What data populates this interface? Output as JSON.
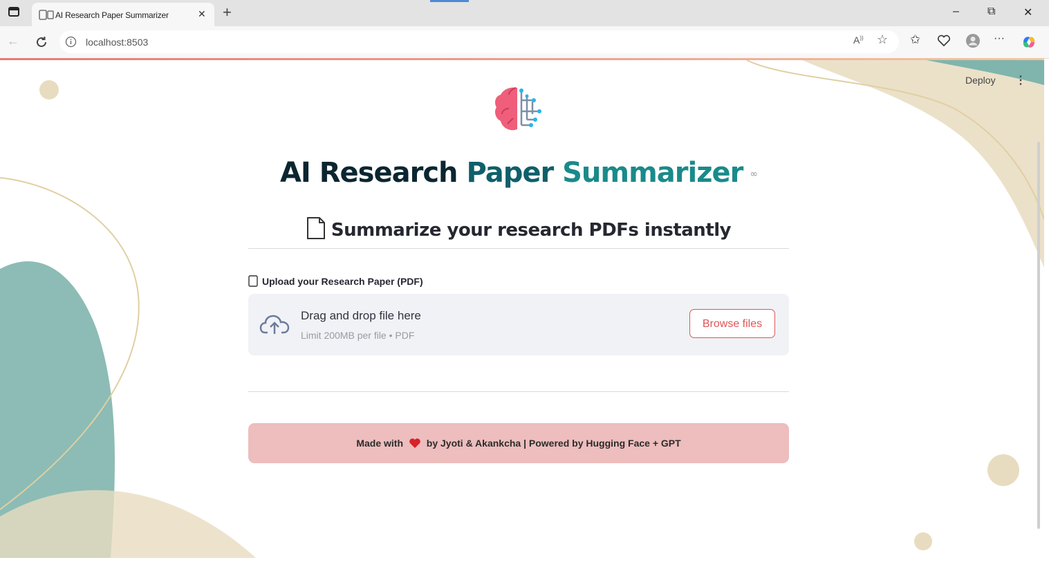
{
  "browser": {
    "tab_title": "AI Research Paper Summarizer",
    "url": "localhost:8503",
    "new_tab_label": "+",
    "minimize": "–",
    "maximize": "⧉",
    "close": "✕",
    "tab_close": "✕"
  },
  "app": {
    "deploy_label": "Deploy",
    "menu_icon": "⋮",
    "title": {
      "part1": "AI Research",
      "part2": "Paper",
      "part3": "Summarizer",
      "anchor": "∞"
    },
    "subtitle": "Summarize your research PDFs instantly",
    "upload": {
      "label": "Upload your Research Paper (PDF)",
      "drag_text": "Drag and drop file here",
      "limit_text": "Limit 200MB per file • PDF",
      "browse_label": "Browse files"
    },
    "footer": {
      "before_heart": "Made with",
      "after_heart": "by Jyoti & Akankcha | Powered by Hugging Face + GPT"
    }
  },
  "icons": {
    "logo": "brain-circuit-icon",
    "document": "document-icon",
    "upload": "cloud-upload-icon",
    "heart": "heart-icon"
  },
  "colors": {
    "title_dark": "#0b2630",
    "title_teal": "#1a8a8a",
    "accent_red": "#e05555",
    "banner_pink": "#eebdbd",
    "decor_teal": "#7fb5ad",
    "decor_beige": "#e8dcc0"
  }
}
